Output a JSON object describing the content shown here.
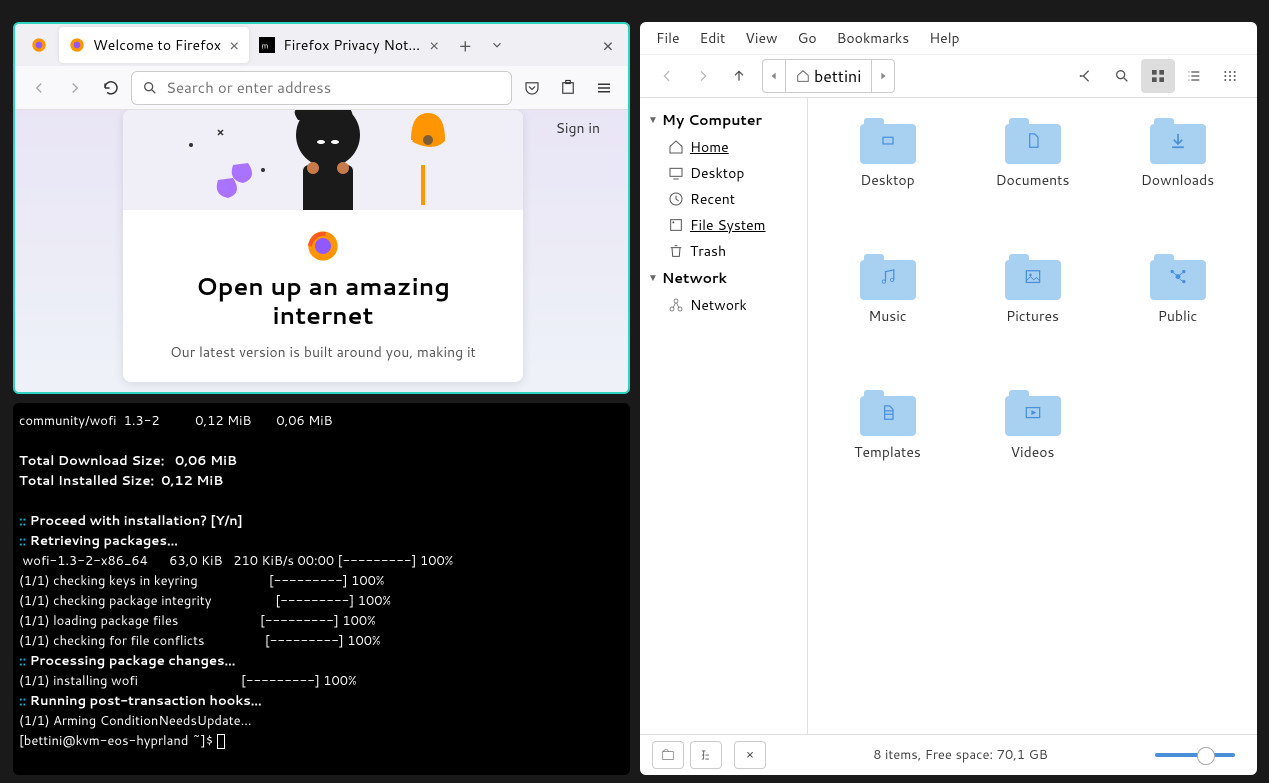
{
  "firefox": {
    "tabs": [
      {
        "title": "Welcome to Firefox",
        "active": true
      },
      {
        "title": "Firefox Privacy Notice —",
        "active": false
      }
    ],
    "urlbar_placeholder": "Search or enter address",
    "signin": "Sign in",
    "card_heading": "Open up an amazing internet",
    "card_sub": "Our latest version is built around you, making it"
  },
  "terminal": {
    "lines": [
      {
        "t": "community/wofi  1.3-2          0,12 MiB       0,06 MiB",
        "cls": ""
      },
      {
        "t": "",
        "cls": ""
      },
      {
        "t": "Total Download Size:   0,06 MiB",
        "cls": "t-bold"
      },
      {
        "t": "Total Installed Size:  0,12 MiB",
        "cls": "t-bold"
      },
      {
        "t": "",
        "cls": ""
      }
    ],
    "proceed_prefix": ":: ",
    "proceed": "Proceed with installation? [Y/n]",
    "retrieving_prefix": ":: ",
    "retrieving": "Retrieving packages...",
    "dl_line": " wofi-1.3-2-x86_64      63,0 KiB   210 KiB/s 00:00 [---------] 100%",
    "check_lines": [
      "(1/1) checking keys in keyring                    [---------] 100%",
      "(1/1) checking package integrity                  [---------] 100%",
      "(1/1) loading package files                       [---------] 100%",
      "(1/1) checking for file conflicts                 [---------] 100%"
    ],
    "processing_prefix": ":: ",
    "processing": "Processing package changes...",
    "install_line": "(1/1) installing wofi                             [---------] 100%",
    "hooks_prefix": ":: ",
    "hooks": "Running post-transaction hooks...",
    "arming": "(1/1) Arming ConditionNeedsUpdate...",
    "prompt": "[bettini@kvm-eos-hyprland ~]$ "
  },
  "fm": {
    "menu": [
      "File",
      "Edit",
      "View",
      "Go",
      "Bookmarks",
      "Help"
    ],
    "path_user": "bettini",
    "side": {
      "computer_label": "My Computer",
      "computer_items": [
        {
          "label": "Home",
          "icon": "home",
          "u": true
        },
        {
          "label": "Desktop",
          "icon": "desktop",
          "u": false
        },
        {
          "label": "Recent",
          "icon": "recent",
          "u": false
        },
        {
          "label": "File System",
          "icon": "fs",
          "u": true
        },
        {
          "label": "Trash",
          "icon": "trash",
          "u": false
        }
      ],
      "network_label": "Network",
      "network_items": [
        {
          "label": "Network",
          "icon": "network",
          "u": false
        }
      ]
    },
    "folders": [
      {
        "label": "Desktop",
        "badge": "desktop"
      },
      {
        "label": "Documents",
        "badge": "doc"
      },
      {
        "label": "Downloads",
        "badge": "download"
      },
      {
        "label": "Music",
        "badge": "music"
      },
      {
        "label": "Pictures",
        "badge": "pic"
      },
      {
        "label": "Public",
        "badge": "public"
      },
      {
        "label": "Templates",
        "badge": "template"
      },
      {
        "label": "Videos",
        "badge": "video"
      }
    ],
    "status": "8 items, Free space: 70,1 GB"
  }
}
